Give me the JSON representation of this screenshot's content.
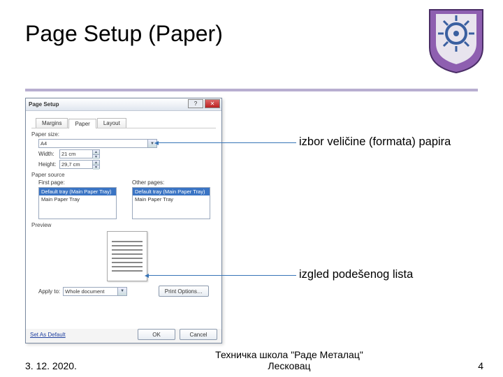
{
  "title": "Page Setup (Paper)",
  "dialog": {
    "caption": "Page Setup",
    "tabs": {
      "margins": "Margins",
      "paper": "Paper",
      "layout": "Layout"
    },
    "paper_size_label": "Paper size:",
    "paper_size_value": "A4",
    "width_label": "Width:",
    "width_value": "21 cm",
    "height_label": "Height:",
    "height_value": "29,7 cm",
    "paper_source_label": "Paper source",
    "first_page_label": "First page:",
    "other_pages_label": "Other pages:",
    "tray_items": [
      "Default tray (Main Paper Tray)",
      "Main Paper Tray"
    ],
    "preview_label": "Preview",
    "apply_to_label": "Apply to:",
    "apply_to_value": "Whole document",
    "print_options": "Print Options…",
    "set_default": "Set As Default",
    "ok": "OK",
    "cancel": "Cancel"
  },
  "annotations": {
    "size": "izbor veličine (formata) papira",
    "preview": "izgled podešenog lista"
  },
  "footer": {
    "date": "3. 12. 2020.",
    "school_line1": "Техничка школа \"Раде Металац\"",
    "school_line2": "Лесковац",
    "page": "4"
  }
}
